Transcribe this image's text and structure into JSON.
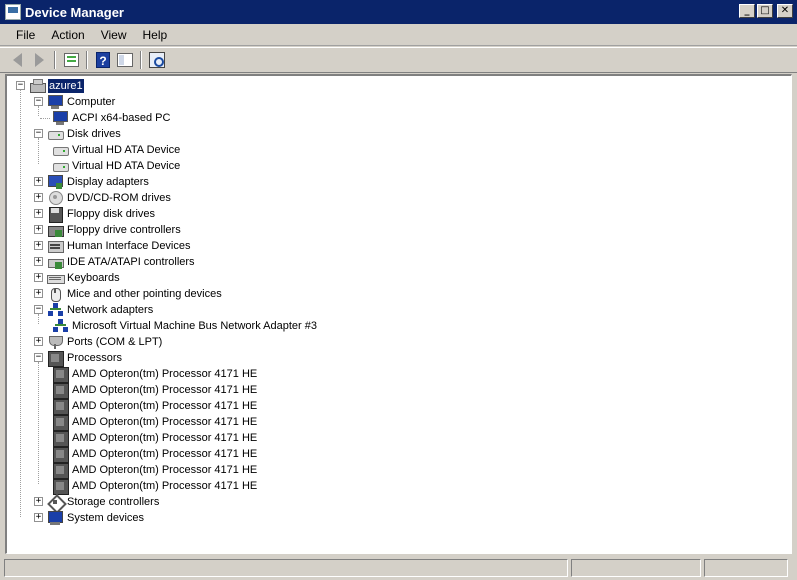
{
  "window": {
    "title": "Device Manager"
  },
  "menu": [
    "File",
    "Action",
    "View",
    "Help"
  ],
  "toolbar": {
    "buttons": [
      "back-icon",
      "forward-icon",
      "properties-icon",
      "help-icon",
      "show-hide-console-tree-icon",
      "scan-hardware-changes-icon"
    ]
  },
  "tree": {
    "root": "azure1",
    "computer": {
      "label": "Computer",
      "children": [
        "ACPI x64-based PC"
      ]
    },
    "disk_drives": {
      "label": "Disk drives",
      "children": [
        "Virtual HD ATA Device",
        "Virtual HD ATA Device"
      ]
    },
    "display_adapters": "Display adapters",
    "dvd": "DVD/CD-ROM drives",
    "floppy_disk": "Floppy disk drives",
    "floppy_ctrl": "Floppy drive controllers",
    "hid": "Human Interface Devices",
    "ide": "IDE ATA/ATAPI controllers",
    "keyboards": "Keyboards",
    "mice": "Mice and other pointing devices",
    "network": {
      "label": "Network adapters",
      "children": [
        "Microsoft Virtual Machine Bus Network Adapter #3"
      ]
    },
    "ports": "Ports (COM & LPT)",
    "processors": {
      "label": "Processors",
      "children": [
        "AMD Opteron(tm) Processor 4171 HE",
        "AMD Opteron(tm) Processor 4171 HE",
        "AMD Opteron(tm) Processor 4171 HE",
        "AMD Opteron(tm) Processor 4171 HE",
        "AMD Opteron(tm) Processor 4171 HE",
        "AMD Opteron(tm) Processor 4171 HE",
        "AMD Opteron(tm) Processor 4171 HE",
        "AMD Opteron(tm) Processor 4171 HE"
      ]
    },
    "storage": "Storage controllers",
    "system": "System devices"
  }
}
